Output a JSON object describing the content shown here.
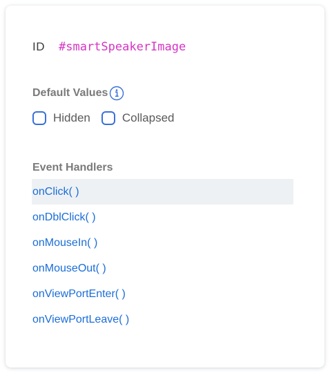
{
  "id_row": {
    "label": "ID",
    "value": "#smartSpeakerImage"
  },
  "default_values": {
    "title": "Default Values",
    "info_icon": "info-icon",
    "options": [
      {
        "label": "Hidden",
        "checked": false
      },
      {
        "label": "Collapsed",
        "checked": false
      }
    ]
  },
  "event_handlers": {
    "title": "Event Handlers",
    "selected_index": 0,
    "items": [
      {
        "label": "onClick( )"
      },
      {
        "label": "onDblClick( )"
      },
      {
        "label": "onMouseIn( )"
      },
      {
        "label": "onMouseOut( )"
      },
      {
        "label": "onViewPortEnter( )"
      },
      {
        "label": "onViewPortLeave( )"
      }
    ]
  },
  "colors": {
    "id_value": "#d634c4",
    "link": "#1a6dd8",
    "checkbox_border": "#3970d8",
    "selected_row_bg": "#eef1f4"
  }
}
